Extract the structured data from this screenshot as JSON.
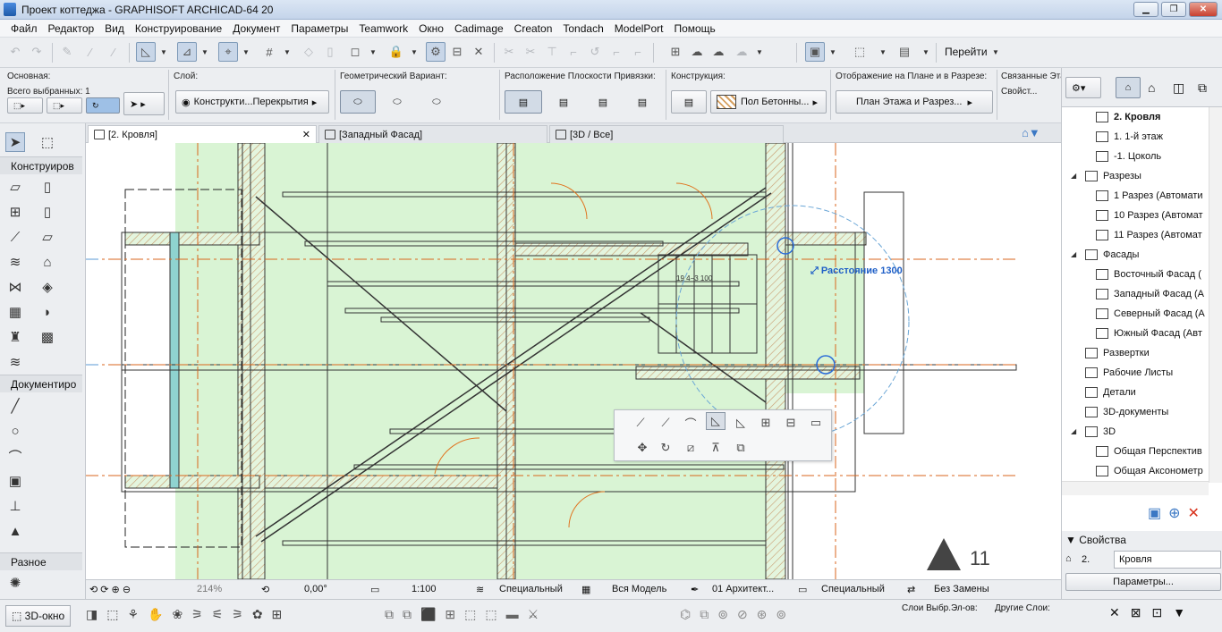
{
  "window": {
    "title": "Проект коттеджа - GRAPHISOFT ARCHICAD-64 20"
  },
  "menu": [
    "Файл",
    "Редактор",
    "Вид",
    "Конструирование",
    "Документ",
    "Параметры",
    "Teamwork",
    "Окно",
    "Cadimage",
    "Creaton",
    "Tondach",
    "ModelPort",
    "Помощь"
  ],
  "toolbar": {
    "goto_label": "Перейти"
  },
  "infobox": {
    "main_label": "Основная:",
    "selected_label": "Всего выбранных: 1",
    "layer_label": "Слой:",
    "layer_value": "Конструкти...Перекрытия",
    "geometry_label": "Геометрический Вариант:",
    "plane_label": "Расположение Плоскости Привязки:",
    "structure_label": "Конструкция:",
    "structure_value": "Пол Бетонны...",
    "display_label": "Отображение на Плане и в Разрезе:",
    "display_value": "План Этажа и Разрез...",
    "linked_label": "Связанные Этаж",
    "props_label": "Свойст..."
  },
  "tabs": [
    {
      "label": "[2. Кровля]",
      "active": true
    },
    {
      "label": "[Западный Фасад]",
      "active": false
    },
    {
      "label": "[3D / Все]",
      "active": false
    }
  ],
  "toolbox": {
    "construct_header": "Конструиров",
    "document_header": "Документиро",
    "misc_header": "Разное"
  },
  "canvas": {
    "tooltip": "Расстояние  1300",
    "stair_label": "19  4−3  100",
    "number": "11"
  },
  "status": {
    "zoom": "214%",
    "angle": "0,00°",
    "scale": "1:100",
    "layers": "Специальный",
    "model": "Вся Модель",
    "pen": "01 Архитект...",
    "structure": "Специальный",
    "override": "Без Замены"
  },
  "bottom": {
    "view3d": "3D-окно",
    "layers_sel": "Слои Выбр.Эл-ов:",
    "layers_other": "Другие Слои:"
  },
  "navigator": {
    "items": [
      {
        "label": "2. Кровля",
        "level": 1,
        "bold": true
      },
      {
        "label": "1. 1-й этаж",
        "level": 1
      },
      {
        "label": "-1. Цоколь",
        "level": 1
      },
      {
        "label": "Разрезы",
        "level": 0,
        "folder": true
      },
      {
        "label": "1 Разрез (Автомати",
        "level": 1
      },
      {
        "label": "10 Разрез (Автомат",
        "level": 1
      },
      {
        "label": "11 Разрез (Автомат",
        "level": 1
      },
      {
        "label": "Фасады",
        "level": 0,
        "folder": true
      },
      {
        "label": "Восточный Фасад (",
        "level": 1
      },
      {
        "label": "Западный Фасад (А",
        "level": 1
      },
      {
        "label": "Северный Фасад (А",
        "level": 1
      },
      {
        "label": "Южный Фасад (Авт",
        "level": 1
      },
      {
        "label": "Развертки",
        "level": 0
      },
      {
        "label": "Рабочие Листы",
        "level": 0
      },
      {
        "label": "Детали",
        "level": 0
      },
      {
        "label": "3D-документы",
        "level": 0
      },
      {
        "label": "3D",
        "level": 0,
        "folder": true
      },
      {
        "label": "Общая Перспектив",
        "level": 1
      },
      {
        "label": "Общая Аксонометр",
        "level": 1
      }
    ]
  },
  "properties": {
    "header": "Свойства",
    "story_num": "2.",
    "story_name": "Кровля",
    "params_button": "Параметры..."
  }
}
